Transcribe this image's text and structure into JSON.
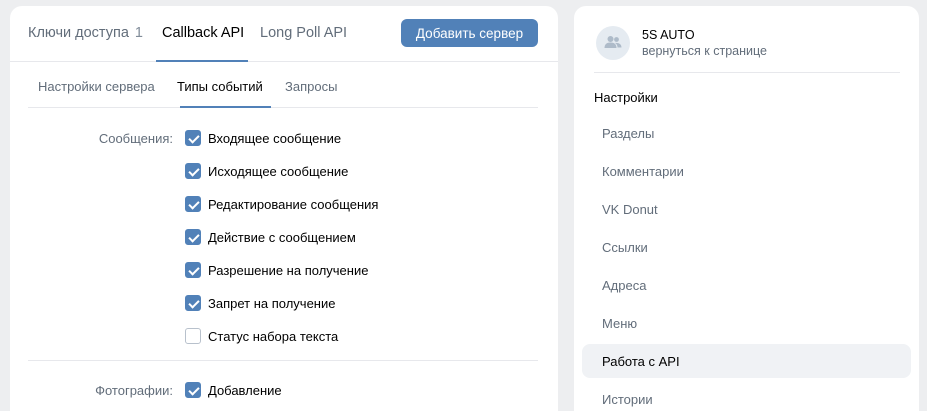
{
  "top_tabs": [
    {
      "label": "Ключи доступа",
      "count": "1"
    },
    {
      "label": "Callback API"
    },
    {
      "label": "Long Poll API"
    }
  ],
  "add_server_label": "Добавить сервер",
  "sub_tabs": [
    {
      "label": "Настройки сервера"
    },
    {
      "label": "Типы событий"
    },
    {
      "label": "Запросы"
    }
  ],
  "groups": [
    {
      "label": "Сообщения:",
      "items": [
        {
          "label": "Входящее сообщение",
          "checked": true
        },
        {
          "label": "Исходящее сообщение",
          "checked": true
        },
        {
          "label": "Редактирование сообщения",
          "checked": true
        },
        {
          "label": "Действие с сообщением",
          "checked": true
        },
        {
          "label": "Разрешение на получение",
          "checked": true
        },
        {
          "label": "Запрет на получение",
          "checked": true
        },
        {
          "label": "Статус набора текста",
          "checked": false
        }
      ]
    },
    {
      "label": "Фотографии:",
      "items": [
        {
          "label": "Добавление",
          "checked": true
        }
      ]
    }
  ],
  "sidebar": {
    "club_name": "5S AUTO",
    "back_link": "вернуться к странице",
    "avatar_icon": "users-icon",
    "heading": "Настройки",
    "items": [
      {
        "label": "Разделы"
      },
      {
        "label": "Комментарии"
      },
      {
        "label": "VK Donut"
      },
      {
        "label": "Ссылки"
      },
      {
        "label": "Адреса"
      },
      {
        "label": "Меню"
      },
      {
        "label": "Работа с API",
        "selected": true
      },
      {
        "label": "Истории"
      }
    ]
  },
  "colors": {
    "accent": "#5181b8",
    "page_bg": "#edeef0",
    "secondary_text": "#626d7a"
  }
}
